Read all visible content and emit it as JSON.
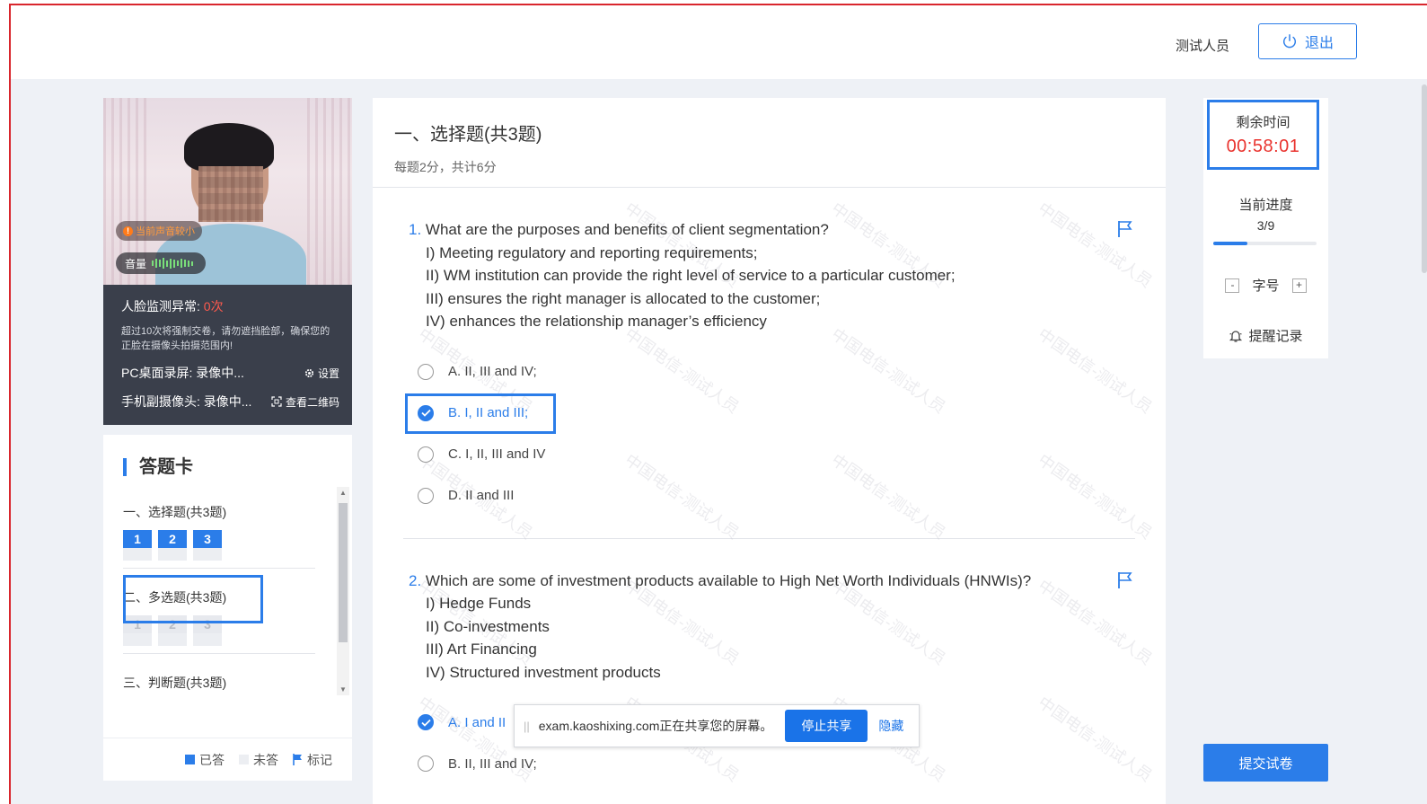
{
  "header": {
    "user_name": "测试人员",
    "logout_label": "退出"
  },
  "camera": {
    "voice_warning": "当前声音较小",
    "volume_label": "音量",
    "face_alert_label": "人脸监测异常:",
    "face_alert_count": "0次",
    "face_note": "超过10次将强制交卷，请勿遮挡脸部，确保您的正脸在摄像头拍摄范围内!",
    "pc_record": "PC桌面录屏: 录像中...",
    "settings_label": "设置",
    "mobile_record": "手机副摄像头: 录像中...",
    "qrcode_label": "查看二维码"
  },
  "answer_card": {
    "title": "答题卡",
    "sections": [
      {
        "title": "一、选择题(共3题)",
        "items": [
          "1",
          "2",
          "3"
        ],
        "state": "answered"
      },
      {
        "title": "二、多选题(共3题)",
        "items": [
          "1",
          "2",
          "3"
        ],
        "state": "empty"
      },
      {
        "title": "三、判断题(共3题)",
        "items": [],
        "state": "empty"
      }
    ],
    "legend": {
      "answered": "已答",
      "unanswered": "未答",
      "flagged": "标记"
    },
    "colors": {
      "answered": "#2b7de9",
      "unanswered": "#eceef2",
      "flagged": "#2b7de9"
    }
  },
  "main": {
    "section_title": "一、选择题(共3题)",
    "section_sub": "每题2分，共计6分",
    "questions": [
      {
        "num": "1.",
        "stem": "What are the purposes and benefits of client segmentation?",
        "lines": [
          "I) Meeting regulatory and reporting requirements;",
          "II) WM institution can provide the right level of service to a particular customer;",
          "III) ensures the right manager is allocated to the customer;",
          "IV) enhances the relationship manager’s efficiency"
        ],
        "options": [
          "A.  II, III and IV;",
          "B.  I, II and III;",
          "C.  I, II, III and IV",
          "D.  II and III"
        ],
        "selected": 1
      },
      {
        "num": "2.",
        "stem": "Which are some of investment products available to High Net Worth Individuals (HNWIs)?",
        "lines": [
          "I) Hedge Funds",
          "II) Co-investments",
          "III) Art Financing",
          "IV) Structured investment products"
        ],
        "options": [
          "A.  I and II",
          "B.  II, III and IV;"
        ],
        "selected": 0
      }
    ],
    "watermark": "中国电信-测试人员"
  },
  "side": {
    "time_label": "剩余时间",
    "time_value": "00:58:01",
    "progress_label": "当前进度",
    "progress_value": "3/9",
    "progress_fraction": 0.333,
    "font_minus": "-",
    "font_label": "字号",
    "font_plus": "+",
    "remind_label": "提醒记录",
    "submit_label": "提交试卷"
  },
  "share_bar": {
    "message": "exam.kaoshixing.com正在共享您的屏幕。",
    "stop_label": "停止共享",
    "hide_label": "隐藏"
  }
}
